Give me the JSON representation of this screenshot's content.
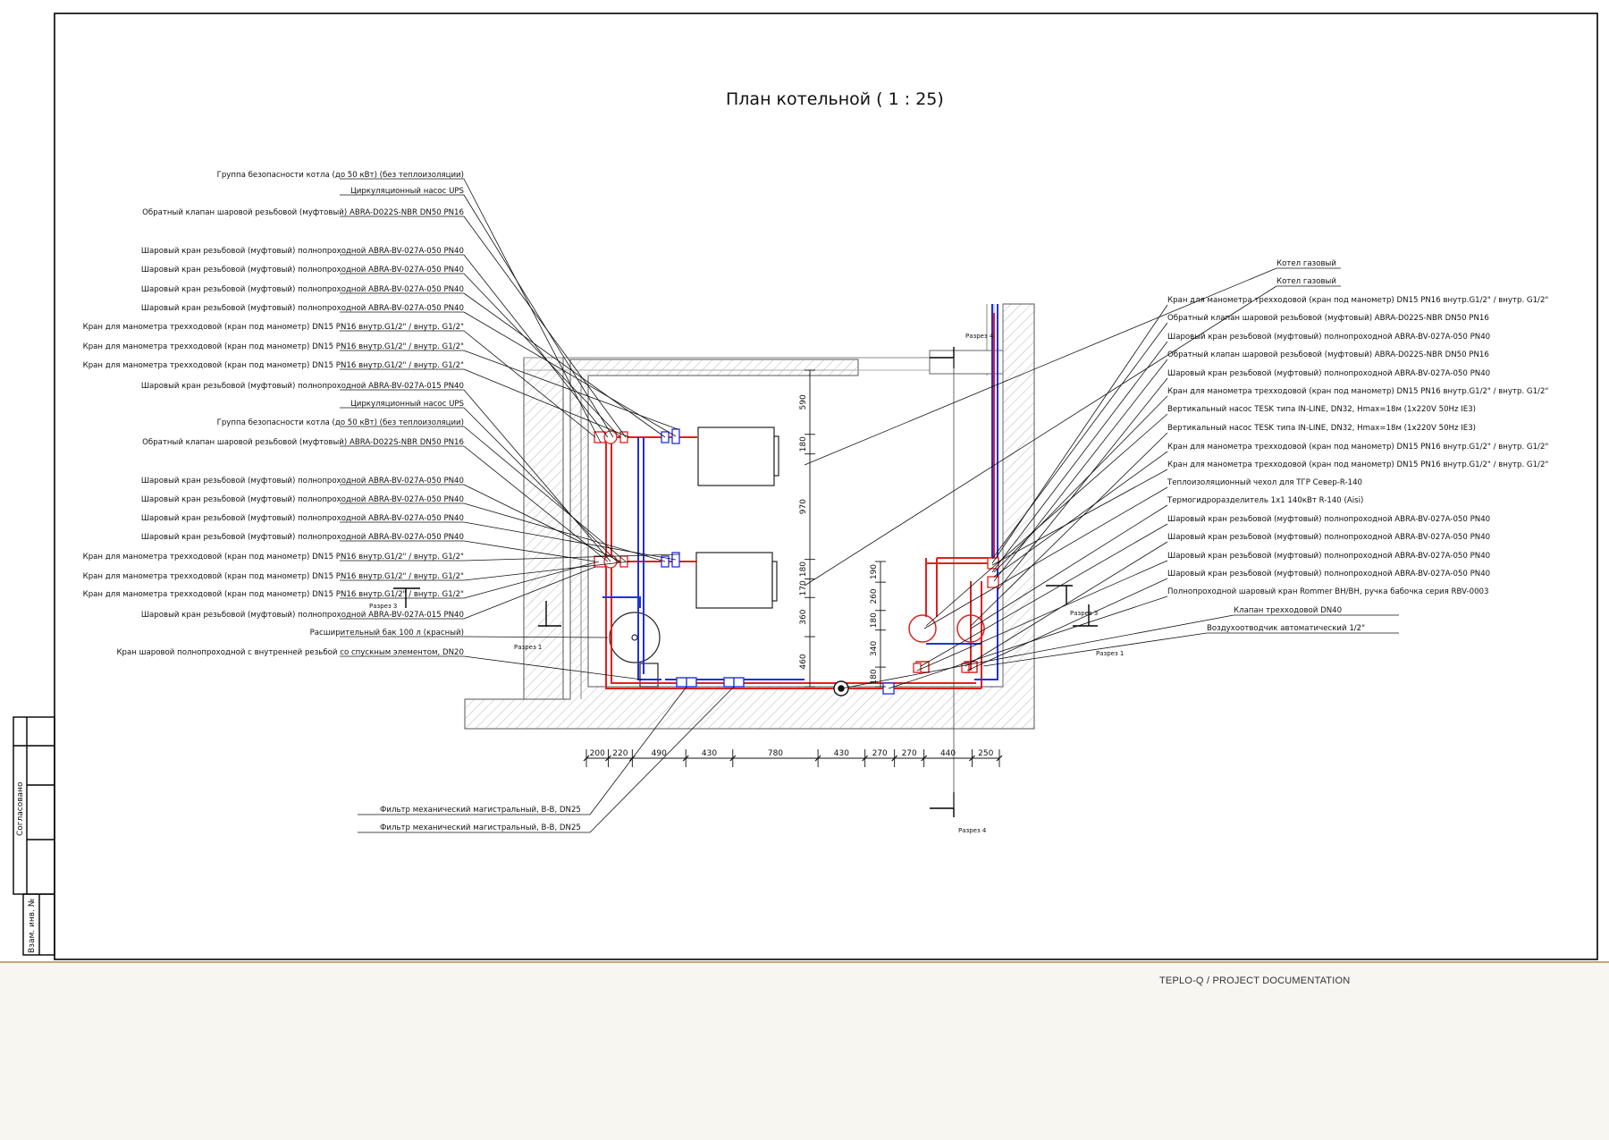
{
  "title": "План котельной ( 1 : 25)",
  "stamp": {
    "agreed": "Согласовано",
    "inv_no": "Взам. инв. №"
  },
  "footer": {
    "text": "TEPLO-Q / PROJECT DOCUMENTATION"
  },
  "colors": {
    "supply": "#e02020",
    "return": "#2030e0",
    "frame": "#000000",
    "footer_bg": "#f7f6f1",
    "footer_line": "#c9a66b"
  },
  "left_labels": [
    "Группа безопасности котла (до 50 кВт) (без теплоизоляции)",
    "Циркуляционный насос UPS",
    "Обратный клапан шаровой резьбовой (муфтовый) ABRA-D022S-NBR DN50 PN16",
    "Шаровый кран резьбовой (муфтовый) полнопроходной ABRA-BV-027A-050 PN40",
    "Шаровый кран резьбовой (муфтовый) полнопроходной ABRA-BV-027A-050 PN40",
    "Шаровый кран резьбовой (муфтовый) полнопроходной ABRA-BV-027A-050 PN40",
    "Шаровый кран резьбовой (муфтовый) полнопроходной ABRA-BV-027A-050 PN40",
    "Кран для манометра трехходовой (кран под манометр) DN15 PN16 внутр.G1/2\" / внутр. G1/2\"",
    "Кран для манометра трехходовой (кран под манометр) DN15 PN16 внутр.G1/2\" / внутр. G1/2\"",
    "Кран для манометра трехходовой (кран под манометр) DN15 PN16 внутр.G1/2\" / внутр. G1/2\"",
    "Шаровый кран резьбовой (муфтовый) полнопроходной ABRA-BV-027A-015 PN40",
    "Циркуляционный насос UPS",
    "Группа безопасности котла (до 50 кВт) (без теплоизоляции)",
    "Обратный клапан шаровой резьбовой (муфтовый) ABRA-D022S-NBR DN50 PN16",
    "Шаровый кран резьбовой (муфтовый) полнопроходной ABRA-BV-027A-050 PN40",
    "Шаровый кран резьбовой (муфтовый) полнопроходной ABRA-BV-027A-050 PN40",
    "Шаровый кран резьбовой (муфтовый) полнопроходной ABRA-BV-027A-050 PN40",
    "Шаровый кран резьбовой (муфтовый) полнопроходной ABRA-BV-027A-050 PN40",
    "Кран для манометра трехходовой (кран под манометр) DN15 PN16 внутр.G1/2\" / внутр. G1/2\"",
    "Кран для манометра трехходовой (кран под манометр) DN15 PN16 внутр.G1/2\" / внутр. G1/2\"",
    "Кран для манометра трехходовой (кран под манометр) DN15 PN16 внутр.G1/2\" / внутр. G1/2\"",
    "Шаровый кран резьбовой (муфтовый) полнопроходной ABRA-BV-027A-015 PN40",
    "Расширительный бак 100 л (красный)",
    "Кран шаровой полнопроходной с внутренней резьбой со спускным элементом, DN20"
  ],
  "right_labels": [
    "Котел газовый",
    "Котел газовый",
    "Кран для манометра трехходовой (кран под манометр) DN15 PN16 внутр.G1/2\" / внутр. G1/2\"",
    "Обратный клапан шаровой резьбовой (муфтовый) ABRA-D022S-NBR DN50 PN16",
    "Шаровый кран резьбовой (муфтовый) полнопроходной ABRA-BV-027A-050 PN40",
    "Обратный клапан шаровой резьбовой (муфтовый) ABRA-D022S-NBR DN50 PN16",
    "Шаровый кран резьбовой (муфтовый) полнопроходной ABRA-BV-027A-050 PN40",
    "Кран для манометра трехходовой (кран под манометр) DN15 PN16 внутр.G1/2\" / внутр. G1/2\"",
    "Вертикальный насос TESK типа IN-LINE, DN32, Hmax=18м (1х220V 50Hz IE3)",
    "Вертикальный насос TESK типа IN-LINE, DN32, Hmax=18м (1х220V 50Hz IE3)",
    "Кран для манометра трехходовой (кран под манометр) DN15 PN16 внутр.G1/2\" / внутр. G1/2\"",
    "Кран для манометра трехходовой (кран под манометр) DN15 PN16 внутр.G1/2\" / внутр. G1/2\"",
    "Теплоизоляционный чехол для ТГР Север-R-140",
    "Термогидроразделитель 1х1 140кВт R-140 (Aisi)",
    "Шаровый кран резьбовой (муфтовый) полнопроходной ABRA-BV-027A-050 PN40",
    "Шаровый кран резьбовой (муфтовый) полнопроходной ABRA-BV-027A-050 PN40",
    "Шаровый кран резьбовой (муфтовый) полнопроходной ABRA-BV-027A-050 PN40",
    "Шаровый кран резьбовой (муфтовый) полнопроходной ABRA-BV-027A-050 PN40",
    "Полнопроходной шаровый кран Rommer ВН/ВН, ручка бабочка серия RBV-0003",
    "Клапан трехходовой DN40",
    "Воздухоотводчик автоматический 1/2\""
  ],
  "bottom_labels": [
    "Фильтр механический магистральный, В-В, DN25",
    "Фильтр механический магистральный, В-В, DN25"
  ],
  "section_marks": {
    "r4_top": "Разрез 4",
    "r4_bottom": "Разрез 4",
    "r3_left": "Разрез 3",
    "r3_right": "Разрез 3",
    "r1_left": "Разрез 1",
    "r1_right": "Разрез 1"
  },
  "dims_horizontal": [
    "200",
    "220",
    "490",
    "430",
    "780",
    "430",
    "270",
    "270",
    "440",
    "250"
  ],
  "dims_vertical_left": [
    "590",
    "180",
    "970",
    "180",
    "170",
    "360",
    "460"
  ],
  "dims_vertical_right": [
    "190",
    "260",
    "180",
    "340",
    "180"
  ]
}
